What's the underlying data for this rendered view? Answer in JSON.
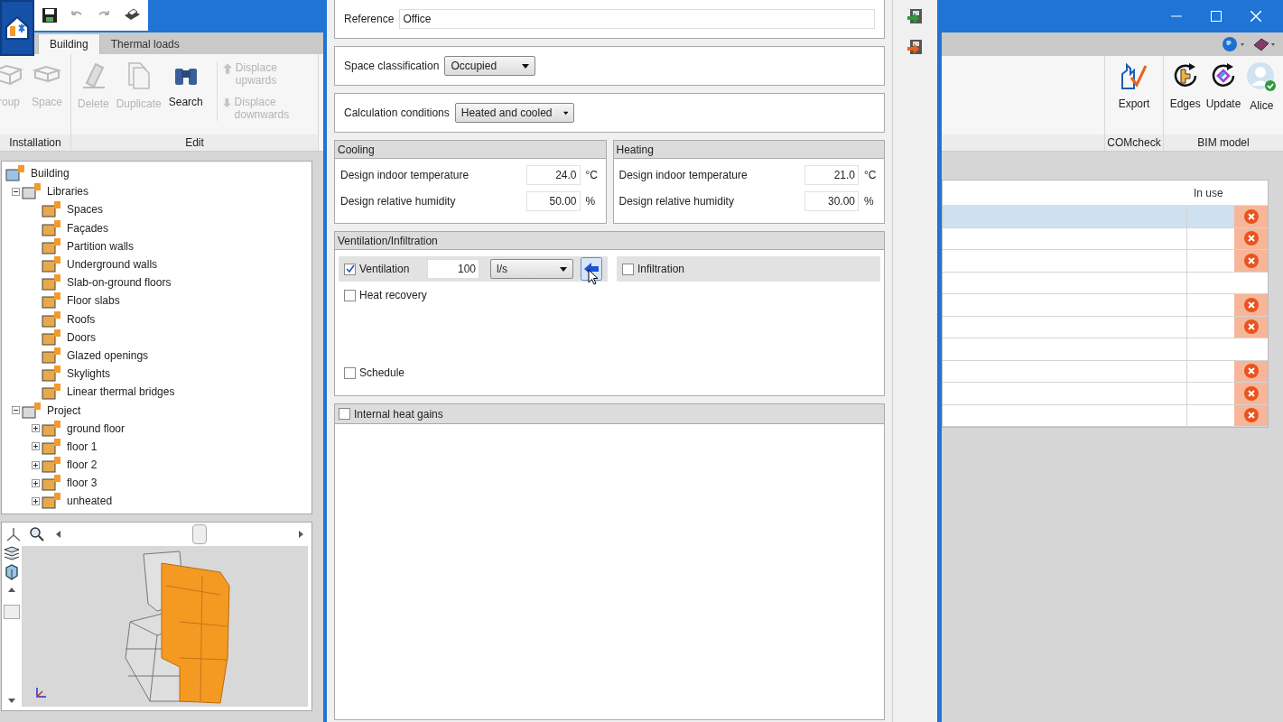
{
  "main_window": {
    "tabs": [
      {
        "label": "Building",
        "selected": true
      },
      {
        "label": "Thermal loads",
        "selected": false
      }
    ],
    "ribbon_groups": [
      {
        "label": "Installation",
        "buttons": [
          {
            "label": "roup",
            "disabled": true
          },
          {
            "label": "Space",
            "disabled": true
          }
        ]
      },
      {
        "label": "Edit",
        "buttons": [
          {
            "label": "Delete",
            "disabled": true
          },
          {
            "label": "Duplicate",
            "disabled": true
          },
          {
            "label": "Search",
            "disabled": false
          }
        ],
        "small_buttons": [
          {
            "label": "Displace upwards",
            "disabled": true
          },
          {
            "label": "Displace downwards",
            "disabled": true
          }
        ]
      }
    ],
    "right_ribbon_groups": [
      {
        "label": "COMcheck",
        "buttons": [
          {
            "label": "Export"
          }
        ]
      },
      {
        "label": "BIM model",
        "buttons": [
          {
            "label": "Edges"
          },
          {
            "label": "Update"
          },
          {
            "label": "Alice"
          }
        ]
      }
    ],
    "tree": [
      {
        "label": "Building",
        "children": [
          {
            "label": "Libraries",
            "expanded": true,
            "children": [
              {
                "label": "Spaces"
              },
              {
                "label": "Façades"
              },
              {
                "label": "Partition walls"
              },
              {
                "label": "Underground walls"
              },
              {
                "label": "Slab-on-ground floors"
              },
              {
                "label": "Floor slabs"
              },
              {
                "label": "Roofs"
              },
              {
                "label": "Doors"
              },
              {
                "label": "Glazed openings"
              },
              {
                "label": "Skylights"
              },
              {
                "label": "Linear thermal bridges"
              }
            ]
          },
          {
            "label": "Project",
            "expanded": true,
            "children": [
              {
                "label": "ground floor",
                "expanded": false
              },
              {
                "label": "floor 1",
                "expanded": false
              },
              {
                "label": "floor 2",
                "expanded": false
              },
              {
                "label": "floor 3",
                "expanded": false
              },
              {
                "label": "unheated",
                "expanded": false
              }
            ]
          }
        ]
      }
    ],
    "table": {
      "columns": [
        "In use"
      ],
      "rows": [
        {
          "selected": true,
          "unused": true
        },
        {
          "selected": false,
          "unused": true
        },
        {
          "selected": false,
          "unused": true
        },
        {
          "selected": false,
          "unused": false
        },
        {
          "selected": false,
          "unused": true
        },
        {
          "selected": false,
          "unused": true
        },
        {
          "selected": false,
          "unused": false
        },
        {
          "selected": false,
          "unused": true
        },
        {
          "selected": false,
          "unused": true
        },
        {
          "selected": false,
          "unused": true
        }
      ]
    }
  },
  "dialog": {
    "reference": {
      "label": "Reference",
      "value": "Office"
    },
    "space_classification": {
      "label": "Space classification",
      "value": "Occupied"
    },
    "calculation_conditions": {
      "label": "Calculation conditions",
      "value": "Heated and cooled"
    },
    "groups": [
      {
        "title": "Cooling",
        "fields": [
          {
            "label": "Design indoor temperature",
            "value": "24.0",
            "unit": "°C"
          },
          {
            "label": "Design relative humidity",
            "value": "50.00",
            "unit": "%"
          }
        ]
      },
      {
        "title": "Heating",
        "fields": [
          {
            "label": "Design indoor temperature",
            "value": "21.0",
            "unit": "°C"
          },
          {
            "label": "Design relative humidity",
            "value": "30.00",
            "unit": "%"
          }
        ]
      }
    ],
    "ventilation": {
      "title": "Ventilation/Infiltration",
      "ventilation": {
        "label": "Ventilation",
        "checked": true,
        "value": "100",
        "unit": "l/s"
      },
      "infiltration": {
        "label": "Infiltration",
        "checked": false
      },
      "heat_recovery": {
        "label": "Heat recovery",
        "checked": false
      },
      "schedule": {
        "label": "Schedule",
        "checked": false
      }
    },
    "internal_heat_gains": {
      "label": "Internal heat gains",
      "checked": false
    }
  }
}
